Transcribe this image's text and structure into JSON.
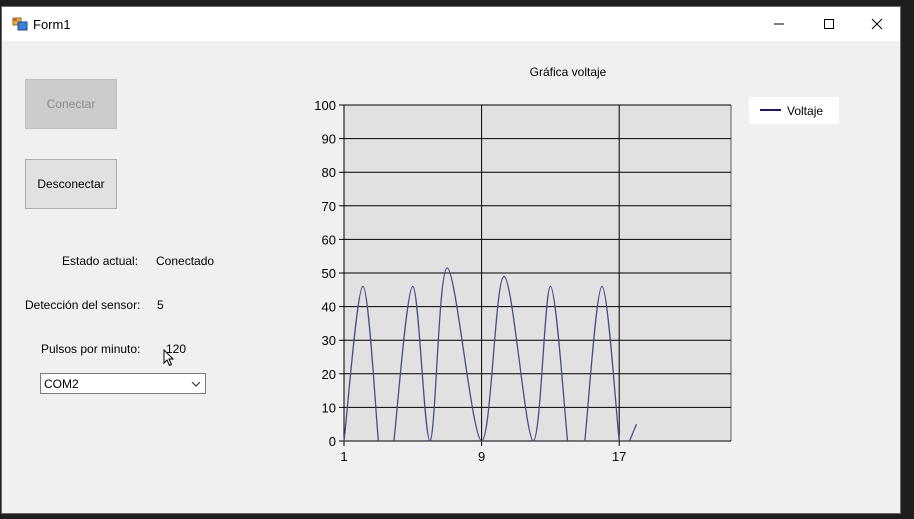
{
  "window": {
    "title": "Form1",
    "controls": {
      "minimize": "minimize",
      "maximize": "maximize",
      "close": "close"
    }
  },
  "buttons": {
    "connect_label": "Conectar",
    "connect_enabled": false,
    "disconnect_label": "Desconectar"
  },
  "status": {
    "state_label": "Estado actual:",
    "state_value": "Conectado",
    "sensor_label": "Detección del sensor:",
    "sensor_value": "5",
    "pulse_label": "Pulsos por minuto:",
    "pulse_value": "120"
  },
  "port_select": {
    "selected": "COM2"
  },
  "colors": {
    "series": "#4b4b8c",
    "legend_line": "#1a1a5e",
    "plot_bg": "#e1e1e1",
    "grid": "#000000"
  },
  "chart_data": {
    "type": "line",
    "title": "Gráfica voltaje",
    "legend": [
      "Voltaje"
    ],
    "legend_position": "top-right",
    "xlim": [
      1,
      23.5
    ],
    "ylim": [
      0,
      100
    ],
    "x_ticks": [
      1,
      9,
      17
    ],
    "y_ticks": [
      0,
      10,
      20,
      30,
      40,
      50,
      60,
      70,
      80,
      90,
      100
    ],
    "grid": true,
    "series": [
      {
        "name": "Voltaje",
        "points": [
          [
            1,
            0
          ],
          [
            2.1,
            46
          ],
          [
            3.0,
            0
          ],
          [
            3.9,
            0
          ],
          [
            5.0,
            46
          ],
          [
            6.0,
            0
          ],
          [
            7.0,
            51.5
          ],
          [
            9,
            0
          ],
          [
            10.3,
            49
          ],
          [
            12.0,
            0
          ],
          [
            13.0,
            46
          ],
          [
            14.0,
            0
          ],
          [
            15.0,
            0
          ],
          [
            16.0,
            46
          ],
          [
            17.0,
            0
          ],
          [
            17.6,
            0
          ],
          [
            18.0,
            5
          ]
        ]
      }
    ]
  }
}
